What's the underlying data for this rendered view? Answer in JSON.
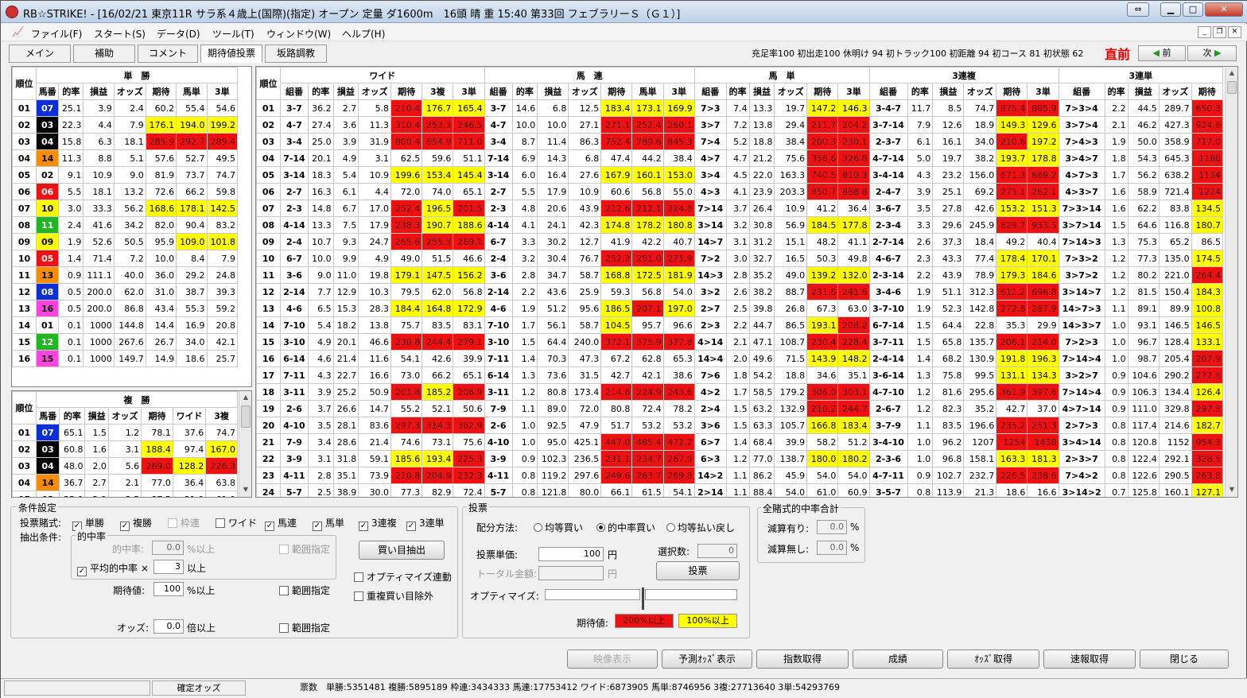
{
  "window": {
    "title": "RB☆STRIKE! - [16/02/21 東京11R サラ系４歳上(国際)(指定) オープン 定量 ダ1600m　16頭 晴 重 15:40 第33回 フェブラリーＳ（Ｇ１）]"
  },
  "menu": [
    "ファイル(F)",
    "スタート(S)",
    "データ(D)",
    "ツール(T)",
    "ウィンドウ(W)",
    "ヘルプ(H)"
  ],
  "tabs": [
    "メイン",
    "補助",
    "コメント",
    "期待値投票",
    "坂路調教"
  ],
  "status_line": "充足率100 初出走100 休明け 94 初トラック100 初距離 94 初コース 81 初状態 62",
  "chokuzen": "直前",
  "nav": {
    "prev": "前",
    "next": "次"
  },
  "tansho": {
    "title": "単　勝",
    "headers": [
      "順位",
      "馬番",
      "的率",
      "損益",
      "オッズ",
      "期待",
      "馬単",
      "3単"
    ],
    "rows": [
      [
        "01",
        "07",
        "25.1",
        "3.9",
        "2.4",
        "60.2",
        "55.4",
        "54.6"
      ],
      [
        "02",
        "03",
        "22.3",
        "4.4",
        "7.9",
        "176.1",
        "194.0",
        "199.2"
      ],
      [
        "03",
        "04",
        "15.8",
        "6.3",
        "18.1",
        "285.9",
        "292.7",
        "289.4"
      ],
      [
        "04",
        "14",
        "11.3",
        "8.8",
        "5.1",
        "57.6",
        "52.7",
        "49.5"
      ],
      [
        "05",
        "02",
        "9.1",
        "10.9",
        "9.0",
        "81.9",
        "73.7",
        "74.7"
      ],
      [
        "06",
        "06",
        "5.5",
        "18.1",
        "13.2",
        "72.6",
        "66.2",
        "59.8"
      ],
      [
        "07",
        "10",
        "3.0",
        "33.3",
        "56.2",
        "168.6",
        "178.1",
        "142.5"
      ],
      [
        "08",
        "11",
        "2.4",
        "41.6",
        "34.2",
        "82.0",
        "90.4",
        "83.2"
      ],
      [
        "09",
        "09",
        "1.9",
        "52.6",
        "50.5",
        "95.9",
        "109.0",
        "101.8"
      ],
      [
        "10",
        "05",
        "1.4",
        "71.4",
        "7.2",
        "10.0",
        "8.4",
        "7.9"
      ],
      [
        "11",
        "13",
        "0.9",
        "111.1",
        "40.0",
        "36.0",
        "29.2",
        "24.8"
      ],
      [
        "12",
        "08",
        "0.5",
        "200.0",
        "62.0",
        "31.0",
        "38.7",
        "39.3"
      ],
      [
        "13",
        "16",
        "0.5",
        "200.0",
        "86.8",
        "43.4",
        "55.3",
        "59.2"
      ],
      [
        "14",
        "01",
        "0.1",
        "1000",
        "144.8",
        "14.4",
        "16.9",
        "20.8"
      ],
      [
        "15",
        "12",
        "0.1",
        "1000",
        "267.6",
        "26.7",
        "34.0",
        "42.1"
      ],
      [
        "16",
        "15",
        "0.1",
        "1000",
        "149.7",
        "14.9",
        "18.6",
        "25.7"
      ]
    ]
  },
  "fukusho": {
    "title": "複　勝",
    "headers": [
      "順位",
      "馬番",
      "的率",
      "損益",
      "オッズ",
      "期待",
      "ワイド",
      "3複"
    ],
    "rows": [
      [
        "01",
        "07",
        "65.1",
        "1.5",
        "1.2",
        "78.1",
        "37.6",
        "74.7"
      ],
      [
        "02",
        "03",
        "60.8",
        "1.6",
        "3.1",
        "188.4",
        "97.4",
        "167.0"
      ],
      [
        "03",
        "04",
        "48.0",
        "2.0",
        "5.6",
        "269.0",
        "128.2",
        "226.3"
      ],
      [
        "04",
        "14",
        "36.7",
        "2.7",
        "2.1",
        "77.0",
        "36.4",
        "63.8"
      ],
      [
        "05",
        "02",
        "35.0",
        "2.9",
        "2.5",
        "87.5",
        "31.0",
        "61.0"
      ]
    ]
  },
  "combo": {
    "groups": [
      "ワイド",
      "馬　連",
      "馬　単",
      "3連複",
      "3連単"
    ],
    "headers": [
      "順位",
      "組番",
      "的率",
      "損益",
      "オッズ",
      "期待",
      "3複",
      "3単",
      "組番",
      "的率",
      "損益",
      "オッズ",
      "期待",
      "馬単",
      "3単",
      "組番",
      "的率",
      "損益",
      "オッズ",
      "期待",
      "3単",
      "組番",
      "的率",
      "損益",
      "オッズ",
      "期待",
      "3単",
      "組番",
      "的率",
      "損益",
      "オッズ",
      "期待"
    ],
    "rows": [
      [
        "01",
        "3-7",
        "36.2",
        "2.7",
        "5.8",
        "210.4",
        "176.7",
        "165.4",
        "3-7",
        "14.6",
        "6.8",
        "12.5",
        "183.4",
        "173.1",
        "169.9",
        "7>3",
        "7.4",
        "13.3",
        "19.7",
        "147.2",
        "146.3",
        "3-4-7",
        "11.7",
        "8.5",
        "74.7",
        "875.4",
        "895.9",
        "7>3>4",
        "2.2",
        "44.5",
        "289.7",
        "650.3"
      ],
      [
        "02",
        "4-7",
        "27.4",
        "3.6",
        "11.3",
        "310.4",
        "253.3",
        "246.5",
        "4-7",
        "10.0",
        "10.0",
        "27.1",
        "271.1",
        "252.4",
        "260.1",
        "3>7",
        "7.2",
        "13.8",
        "29.4",
        "211.7",
        "204.2",
        "3-7-14",
        "7.9",
        "12.6",
        "18.9",
        "149.3",
        "129.6",
        "3>7>4",
        "2.1",
        "46.2",
        "427.3",
        "924.6"
      ],
      [
        "03",
        "3-4",
        "25.0",
        "3.9",
        "31.9",
        "800.4",
        "654.9",
        "711.0",
        "3-4",
        "8.7",
        "11.4",
        "86.3",
        "752.4",
        "789.6",
        "845.3",
        "7>4",
        "5.2",
        "18.8",
        "38.4",
        "200.3",
        "230.1",
        "2-3-7",
        "6.1",
        "16.1",
        "34.0",
        "210.6",
        "197.2",
        "7>4>3",
        "1.9",
        "50.0",
        "358.9",
        "717.0"
      ],
      [
        "04",
        "7-14",
        "20.1",
        "4.9",
        "3.1",
        "62.5",
        "59.6",
        "51.1",
        "7-14",
        "6.9",
        "14.3",
        "6.8",
        "47.4",
        "44.2",
        "38.4",
        "4>7",
        "4.7",
        "21.2",
        "75.6",
        "356.6",
        "326.8",
        "4-7-14",
        "5.0",
        "19.7",
        "38.2",
        "193.7",
        "178.8",
        "3>4>7",
        "1.8",
        "54.3",
        "645.3",
        "1186"
      ],
      [
        "05",
        "3-14",
        "18.3",
        "5.4",
        "10.9",
        "199.6",
        "153.4",
        "145.4",
        "3-14",
        "6.0",
        "16.4",
        "27.6",
        "167.9",
        "160.1",
        "153.0",
        "3>4",
        "4.5",
        "22.0",
        "163.3",
        "740.5",
        "810.3",
        "3-4-14",
        "4.3",
        "23.2",
        "156.0",
        "671.3",
        "689.2",
        "4>7>3",
        "1.7",
        "56.2",
        "638.2",
        "1134"
      ],
      [
        "06",
        "2-7",
        "16.3",
        "6.1",
        "4.4",
        "72.0",
        "74.0",
        "65.1",
        "2-7",
        "5.5",
        "17.9",
        "10.9",
        "60.6",
        "56.8",
        "55.0",
        "4>3",
        "4.1",
        "23.9",
        "203.3",
        "850.7",
        "888.8",
        "2-4-7",
        "3.9",
        "25.1",
        "69.2",
        "275.1",
        "262.1",
        "4>3>7",
        "1.6",
        "58.9",
        "721.4",
        "1224"
      ],
      [
        "07",
        "2-3",
        "14.8",
        "6.7",
        "17.0",
        "252.4",
        "196.5",
        "201.5",
        "2-3",
        "4.8",
        "20.6",
        "43.9",
        "212.6",
        "212.1",
        "224.8",
        "7>14",
        "3.7",
        "26.4",
        "10.9",
        "41.2",
        "36.4",
        "3-6-7",
        "3.5",
        "27.8",
        "42.6",
        "153.2",
        "151.3",
        "7>3>14",
        "1.6",
        "62.2",
        "83.8",
        "134.5"
      ],
      [
        "08",
        "4-14",
        "13.3",
        "7.5",
        "17.9",
        "238.3",
        "190.7",
        "188.6",
        "4-14",
        "4.1",
        "24.1",
        "42.3",
        "174.8",
        "178.2",
        "180.8",
        "3>14",
        "3.2",
        "30.8",
        "56.9",
        "184.5",
        "177.8",
        "2-3-4",
        "3.3",
        "29.6",
        "245.9",
        "829.7",
        "933.5",
        "3>7>14",
        "1.5",
        "64.6",
        "116.8",
        "180.7"
      ],
      [
        "09",
        "2-4",
        "10.7",
        "9.3",
        "24.7",
        "265.6",
        "255.3",
        "269.1",
        "6-7",
        "3.3",
        "30.2",
        "12.7",
        "41.9",
        "42.2",
        "40.7",
        "14>7",
        "3.1",
        "31.2",
        "15.1",
        "48.2",
        "41.1",
        "2-7-14",
        "2.6",
        "37.3",
        "18.4",
        "49.2",
        "40.4",
        "7>14>3",
        "1.3",
        "75.3",
        "65.2",
        "86.5"
      ],
      [
        "10",
        "6-7",
        "10.0",
        "9.9",
        "4.9",
        "49.0",
        "51.5",
        "46.6",
        "2-4",
        "3.2",
        "30.4",
        "76.7",
        "252.2",
        "251.0",
        "271.9",
        "7>2",
        "3.0",
        "32.7",
        "16.5",
        "50.3",
        "49.8",
        "4-6-7",
        "2.3",
        "43.3",
        "77.4",
        "178.4",
        "170.1",
        "7>3>2",
        "1.2",
        "77.3",
        "135.0",
        "174.5"
      ],
      [
        "11",
        "3-6",
        "9.0",
        "11.0",
        "19.8",
        "179.1",
        "147.5",
        "156.2",
        "3-6",
        "2.8",
        "34.7",
        "58.7",
        "168.8",
        "172.5",
        "181.9",
        "14>3",
        "2.8",
        "35.2",
        "49.0",
        "139.2",
        "132.0",
        "2-3-14",
        "2.2",
        "43.9",
        "78.9",
        "179.3",
        "184.6",
        "3>7>2",
        "1.2",
        "80.2",
        "221.0",
        "264.4"
      ],
      [
        "12",
        "2-14",
        "7.7",
        "12.9",
        "10.3",
        "79.5",
        "62.0",
        "56.8",
        "2-14",
        "2.2",
        "43.6",
        "25.9",
        "59.3",
        "56.8",
        "54.0",
        "3>2",
        "2.6",
        "38.2",
        "88.7",
        "231.6",
        "241.6",
        "3-4-6",
        "1.9",
        "51.1",
        "312.3",
        "611.2",
        "696.8",
        "3>14>7",
        "1.2",
        "81.5",
        "150.4",
        "184.3"
      ],
      [
        "13",
        "4-6",
        "6.5",
        "15.3",
        "28.3",
        "184.4",
        "164.8",
        "172.9",
        "4-6",
        "1.9",
        "51.2",
        "95.6",
        "186.5",
        "207.1",
        "197.0",
        "2>7",
        "2.5",
        "39.8",
        "26.8",
        "67.3",
        "63.0",
        "3-7-10",
        "1.9",
        "52.3",
        "142.8",
        "272.8",
        "287.9",
        "14>7>3",
        "1.1",
        "89.1",
        "89.9",
        "100.8"
      ],
      [
        "14",
        "7-10",
        "5.4",
        "18.2",
        "13.8",
        "75.7",
        "83.5",
        "83.1",
        "7-10",
        "1.7",
        "56.1",
        "58.7",
        "104.5",
        "95.7",
        "96.6",
        "2>3",
        "2.2",
        "44.7",
        "86.5",
        "193.1",
        "208.2",
        "6-7-14",
        "1.5",
        "64.4",
        "22.8",
        "35.3",
        "29.9",
        "14>3>7",
        "1.0",
        "93.1",
        "146.5",
        "146.5"
      ],
      [
        "15",
        "3-10",
        "4.9",
        "20.1",
        "46.6",
        "230.8",
        "244.4",
        "279.1",
        "3-10",
        "1.5",
        "64.4",
        "240.0",
        "372.1",
        "375.9",
        "377.8",
        "4>14",
        "2.1",
        "47.1",
        "108.7",
        "230.4",
        "228.4",
        "3-7-11",
        "1.5",
        "65.8",
        "135.7",
        "206.1",
        "214.0",
        "7>2>3",
        "1.0",
        "96.7",
        "128.4",
        "133.1"
      ],
      [
        "16",
        "6-14",
        "4.6",
        "21.4",
        "11.6",
        "54.1",
        "42.6",
        "39.9",
        "7-11",
        "1.4",
        "70.3",
        "47.3",
        "67.2",
        "62.8",
        "65.3",
        "14>4",
        "2.0",
        "49.6",
        "71.5",
        "143.9",
        "148.2",
        "2-4-14",
        "1.4",
        "68.2",
        "130.9",
        "191.8",
        "196.3",
        "7>14>4",
        "1.0",
        "98.7",
        "205.4",
        "207.9"
      ],
      [
        "17",
        "7-11",
        "4.3",
        "22.7",
        "16.6",
        "73.0",
        "66.2",
        "65.1",
        "6-14",
        "1.3",
        "73.6",
        "31.5",
        "42.7",
        "42.1",
        "38.6",
        "7>6",
        "1.8",
        "54.2",
        "18.8",
        "34.6",
        "35.1",
        "3-6-14",
        "1.3",
        "75.8",
        "99.5",
        "131.1",
        "134.3",
        "3>2>7",
        "0.9",
        "104.6",
        "290.2",
        "277.8"
      ],
      [
        "18",
        "3-11",
        "3.9",
        "25.2",
        "50.9",
        "201.8",
        "185.2",
        "206.9",
        "3-11",
        "1.2",
        "80.8",
        "173.4",
        "214.6",
        "224.9",
        "243.6",
        "4>2",
        "1.7",
        "58.5",
        "179.2",
        "306.0",
        "303.1",
        "4-7-10",
        "1.2",
        "81.6",
        "295.6",
        "361.9",
        "397.6",
        "7>14>4",
        "0.9",
        "106.3",
        "134.4",
        "126.4"
      ],
      [
        "19",
        "2-6",
        "3.7",
        "26.6",
        "14.7",
        "55.2",
        "52.1",
        "50.6",
        "7-9",
        "1.1",
        "89.0",
        "72.0",
        "80.8",
        "72.4",
        "78.2",
        "2>4",
        "1.5",
        "63.2",
        "132.9",
        "210.2",
        "244.7",
        "2-6-7",
        "1.2",
        "82.3",
        "35.2",
        "42.7",
        "37.0",
        "4>7>14",
        "0.9",
        "111.0",
        "329.8",
        "297.8"
      ],
      [
        "20",
        "4-10",
        "3.5",
        "28.1",
        "83.6",
        "297.3",
        "314.3",
        "362.9",
        "2-6",
        "1.0",
        "92.5",
        "47.9",
        "51.7",
        "53.2",
        "53.2",
        "3>6",
        "1.5",
        "63.3",
        "105.7",
        "166.8",
        "183.4",
        "3-7-9",
        "1.1",
        "83.5",
        "196.6",
        "235.2",
        "251.3",
        "2>7>3",
        "0.8",
        "117.4",
        "214.6",
        "182.7"
      ],
      [
        "21",
        "7-9",
        "3.4",
        "28.6",
        "21.4",
        "74.6",
        "73.1",
        "75.6",
        "4-10",
        "1.0",
        "95.0",
        "425.1",
        "447.0",
        "485.4",
        "472.2",
        "6>7",
        "1.4",
        "68.4",
        "39.9",
        "58.2",
        "51.2",
        "3-4-10",
        "1.0",
        "96.2",
        "1207",
        "1254",
        "1438",
        "3>4>14",
        "0.8",
        "120.8",
        "1152",
        "954.3"
      ],
      [
        "22",
        "3-9",
        "3.1",
        "31.8",
        "59.1",
        "185.6",
        "193.4",
        "225.3",
        "3-9",
        "0.9",
        "102.3",
        "236.5",
        "231.1",
        "234.7",
        "267.9",
        "6>3",
        "1.2",
        "77.0",
        "138.7",
        "180.0",
        "180.2",
        "2-3-6",
        "1.0",
        "96.8",
        "158.1",
        "163.3",
        "181.3",
        "2>3>7",
        "0.8",
        "122.4",
        "292.1",
        "328.5"
      ],
      [
        "23",
        "4-11",
        "2.8",
        "35.1",
        "73.9",
        "210.8",
        "204.9",
        "232.3",
        "4-11",
        "0.8",
        "119.2",
        "297.6",
        "249.6",
        "263.7",
        "269.8",
        "14>2",
        "1.1",
        "86.2",
        "45.9",
        "54.0",
        "54.0",
        "4-7-11",
        "0.9",
        "102.7",
        "232.7",
        "226.5",
        "238.6",
        "7>4>2",
        "0.8",
        "122.6",
        "290.5",
        "263.8"
      ],
      [
        "24",
        "5-7",
        "2.5",
        "38.9",
        "30.0",
        "77.3",
        "82.9",
        "72.4",
        "5-7",
        "0.8",
        "121.8",
        "80.0",
        "66.1",
        "61.5",
        "54.1",
        "2>14",
        "1.1",
        "88.4",
        "54.0",
        "61.0",
        "60.9",
        "3-5-7",
        "0.8",
        "113.9",
        "21.3",
        "18.6",
        "16.6",
        "3>14>2",
        "0.7",
        "125.8",
        "160.1",
        "127.1"
      ]
    ]
  },
  "conditions": {
    "title": "条件設定",
    "bet_types_label": "投票賭式:",
    "bet_types": [
      {
        "label": "単勝",
        "checked": true
      },
      {
        "label": "複勝",
        "checked": true
      },
      {
        "label": "枠連",
        "checked": false,
        "disabled": true
      },
      {
        "label": "ワイド",
        "checked": false
      },
      {
        "label": "馬連",
        "checked": true
      },
      {
        "label": "馬単",
        "checked": true
      },
      {
        "label": "3連複",
        "checked": true
      },
      {
        "label": "3連単",
        "checked": true
      }
    ],
    "extract_label": "抽出条件:",
    "hit_group": "的中率",
    "hit_rate_label": "的中率:",
    "hit_rate_value": "0.0",
    "hit_rate_unit": "%以上",
    "range_label": "範囲指定",
    "avg_hit_label": "平均的中率 ×",
    "avg_hit_value": "3",
    "avg_hit_unit": "以上",
    "ev_label": "期待値:",
    "ev_value": "100",
    "ev_unit": "%以上",
    "odds_label": "オッズ:",
    "odds_value": "0.0",
    "odds_unit": "倍以上",
    "extract_button": "買い目抽出",
    "optimize_link": "オプティマイズ連動",
    "dup_exclude": "重複買い目除外"
  },
  "voting": {
    "title": "投票",
    "dist_label": "配分方法:",
    "dist_options": [
      "均等買い",
      "的中率買い",
      "均等払い戻し"
    ],
    "dist_selected": 1,
    "unit_label": "投票単価:",
    "unit_value": "100",
    "yen": "円",
    "total_label": "トータル金額:",
    "total_value": "",
    "select_label": "選択数:",
    "select_value": "0",
    "vote_button": "投票",
    "optimize_label": "オプティマイズ:",
    "ev_legend_label": "期待値:",
    "ev_legend_red": "200%以上",
    "ev_legend_yellow": "100%以上"
  },
  "total_hit": {
    "title": "全賭式的中率合計",
    "with_label": "減算有り:",
    "with_value": "0.0",
    "without_label": "減算無し:",
    "without_value": "0.0",
    "pct": "%"
  },
  "buttons": [
    "映像表示",
    "予測ｵｯｽﾞ表示",
    "指数取得",
    "成績",
    "ｵｯｽﾞ取得",
    "速報取得",
    "閉じる"
  ],
  "statusbar": {
    "confirm": "確定オッズ",
    "votes": "票数　単勝:5351481 複勝:5895189 枠連:3434333 馬連:17753412 ワイド:6873905 馬単:8746956 3複:27713640 3単:54293769"
  },
  "horse_colors": {
    "1": "#ffffff",
    "2": "#ffffff",
    "3": "#000000",
    "4": "#000000",
    "5": "#ee1111",
    "6": "#ee1111",
    "7": "#0a2fd6",
    "8": "#0a2fd6",
    "9": "#ffff00",
    "10": "#ffff00",
    "11": "#22b522",
    "12": "#22b522",
    "13": "#ff8c00",
    "14": "#ff8c00",
    "15": "#ff44dd",
    "16": "#ff44dd"
  },
  "colors": {
    "red": "#ee1111",
    "yellow": "#ffff00",
    "accent": "#e00000"
  }
}
